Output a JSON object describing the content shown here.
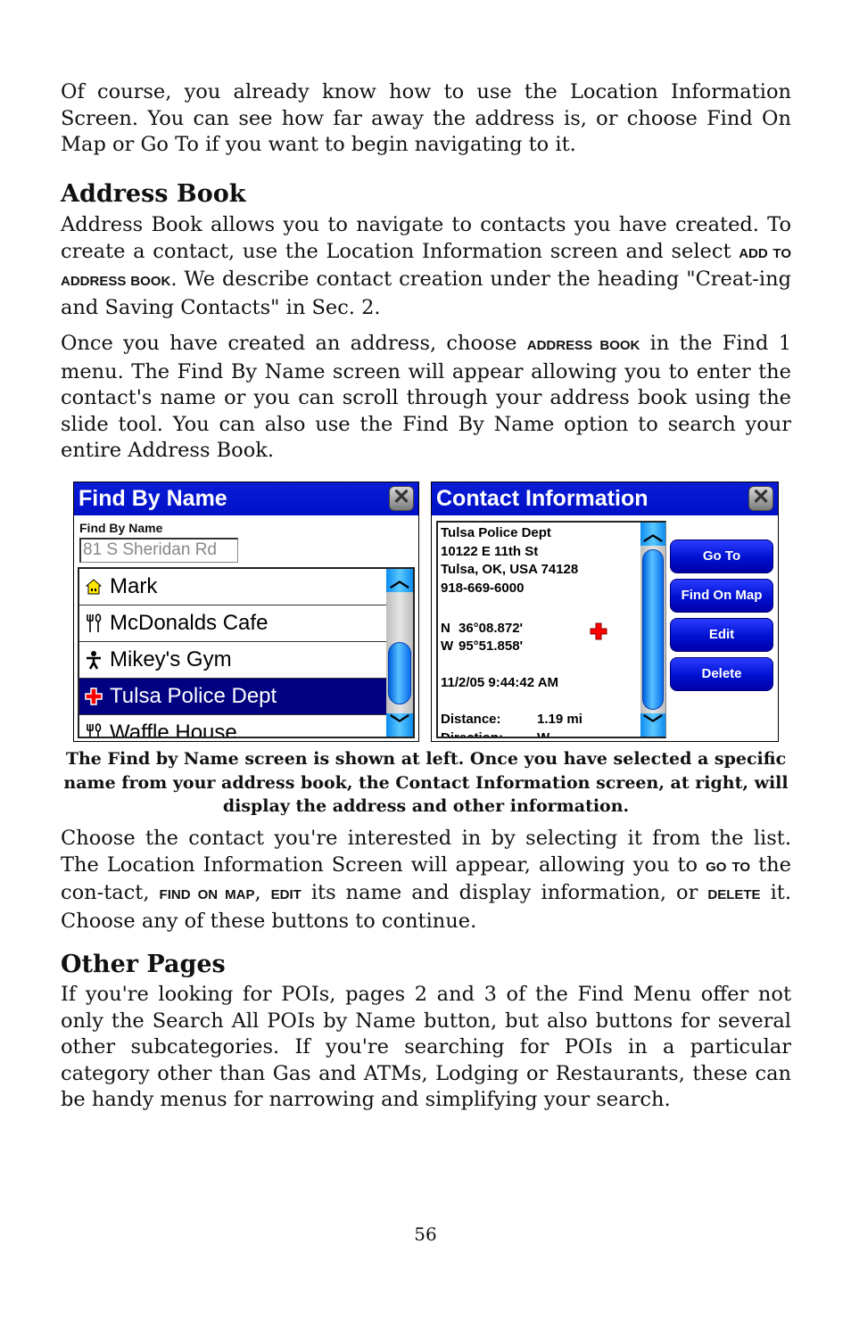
{
  "intro": {
    "text": "Of course, you already know how to use the Location Information Screen. You can see how far away the address is, or choose Find On Map or Go To if you want to begin navigating to it."
  },
  "address_book": {
    "heading": "Address Book",
    "p1_a": "Address Book allows you to navigate to contacts you have created. To create a contact, use the Location Information screen and select ",
    "p1_cmd": "Add to Address Book",
    "p1_b": ". We describe contact creation under the heading \"Creat-ing and Saving Contacts\" in Sec. 2.",
    "p2_a": "Once you have created an address, choose ",
    "p2_cmd": "Address Book",
    "p2_b": " in the Find 1 menu. The Find By Name screen will appear allowing you to enter the contact's name or you can scroll through your address book using the slide tool. You can also use the Find By Name option to search your entire Address Book."
  },
  "find_by_name_screen": {
    "title": "Find By Name",
    "close_icon": "close-x-icon",
    "field_label": "Find By Name",
    "input_value": "81 S Sheridan Rd",
    "items": [
      {
        "label": "Mark",
        "icon": "house-icon",
        "selected": false
      },
      {
        "label": "McDonalds Cafe",
        "icon": "fork-knife-icon",
        "selected": false
      },
      {
        "label": "Mikey's Gym",
        "icon": "person-icon",
        "selected": false
      },
      {
        "label": "Tulsa Police Dept",
        "icon": "red-cross-icon",
        "selected": true
      },
      {
        "label": "Waffle House",
        "icon": "fork-knife-icon",
        "selected": false
      }
    ]
  },
  "contact_info_screen": {
    "title": "Contact Information",
    "name": "Tulsa Police Dept",
    "street": "10122 E 11th St",
    "city": "Tulsa, OK, USA 74128",
    "phone": "918-669-6000",
    "lat_dir": "N",
    "lat": "36°08.872'",
    "lon_dir": "W",
    "lon": "95°51.858'",
    "timestamp": "11/2/05 9:44:42 AM",
    "distance_label": "Distance:",
    "distance_value": "1.19 mi",
    "direction_label": "Direction:",
    "direction_value": "W",
    "buttons": {
      "go_to": "Go To",
      "find_on_map": "Find On Map",
      "edit": "Edit",
      "delete": "Delete"
    }
  },
  "caption": "The Find by Name screen is shown at left. Once you have selected a specific name from your address book, the Contact Information screen, at right, will display the address and other information.",
  "choose": {
    "a": "Choose the contact you're interested in by selecting it from the list. The Location Information Screen will appear, allowing you to ",
    "cmd1": "Go To",
    "b": " the con-tact, ",
    "cmd2": "Find On Map",
    "c": ", ",
    "cmd3": "Edit",
    "d": " its name and display information, or ",
    "cmd4": "Delete",
    "e": " it. Choose any of these buttons to continue."
  },
  "other_pages": {
    "heading": "Other Pages",
    "text": "If you're looking for POIs, pages 2 and 3 of the Find Menu offer not only the Search All POIs by Name button, but also buttons for several other subcategories. If you're searching for POIs in a particular category other than Gas and ATMs, Lodging or Restaurants, these can be handy menus for narrowing and simplifying your search."
  },
  "page_number": "56"
}
